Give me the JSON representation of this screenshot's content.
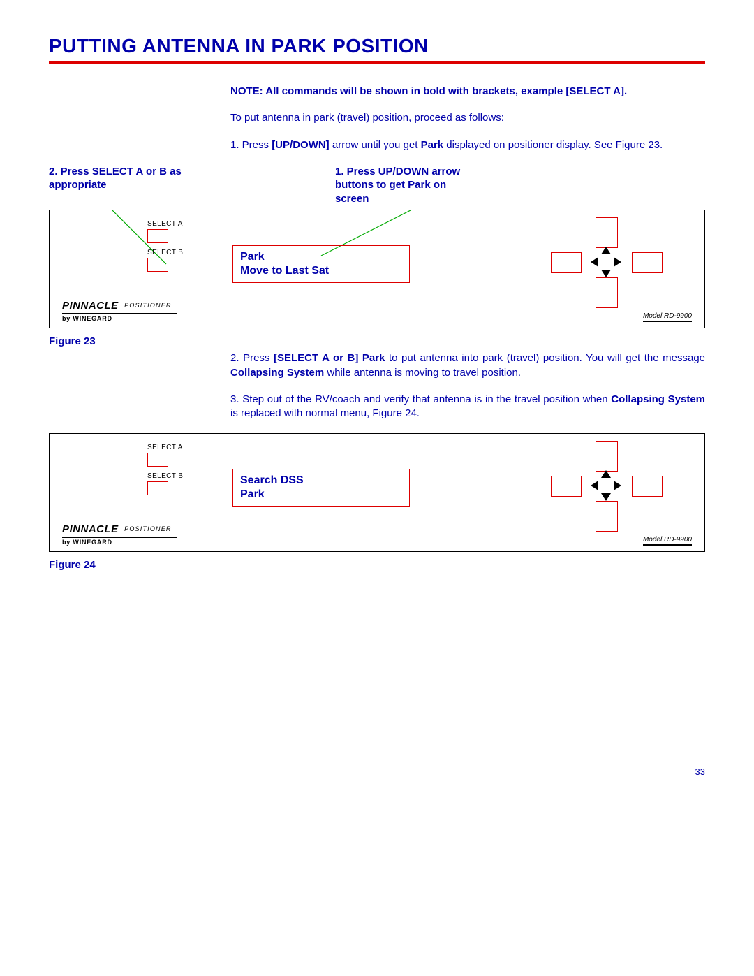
{
  "title": "PUTTING ANTENNA IN PARK POSITION",
  "note": "NOTE:  All commands will be shown in bold with brackets, example [SELECT A].",
  "intro": "To put antenna in park (travel) position, proceed as follows:",
  "step1_a": "1.  Press ",
  "step1_b": "[UP/DOWN]",
  "step1_c": " arrow until you get ",
  "step1_d": "Park",
  "step1_e": " displayed on positioner display.  See Figure 23.",
  "callout_left": "2. Press SELECT A or B as appropriate",
  "callout_right": "1.  Press UP/DOWN arrow buttons to get Park on screen",
  "panel": {
    "select_a": "SELECT A",
    "select_b": "SELECT B",
    "brand": "PINNACLE",
    "brand_sub": "POSITIONER",
    "brand_by": "by WINEGARD",
    "model": "Model RD-9900"
  },
  "lcd1_line1": "Park",
  "lcd1_line2": "Move to Last Sat",
  "fig23": "Figure 23",
  "step2_a": "2.   Press ",
  "step2_b": "[SELECT A or B] Park",
  "step2_c": " to put antenna into park (travel) position.  You will get the message ",
  "step2_d": "Collapsing System",
  "step2_e": " while antenna is moving to travel position.",
  "step3_a": "3.   Step out of the RV/coach and verify that antenna is in the travel position when ",
  "step3_b": "Collapsing System",
  "step3_c": " is replaced with normal menu, Figure 24.",
  "lcd2_line1": "Search    DSS",
  "lcd2_line2": "Park",
  "fig24": "Figure 24",
  "page_number": "33"
}
